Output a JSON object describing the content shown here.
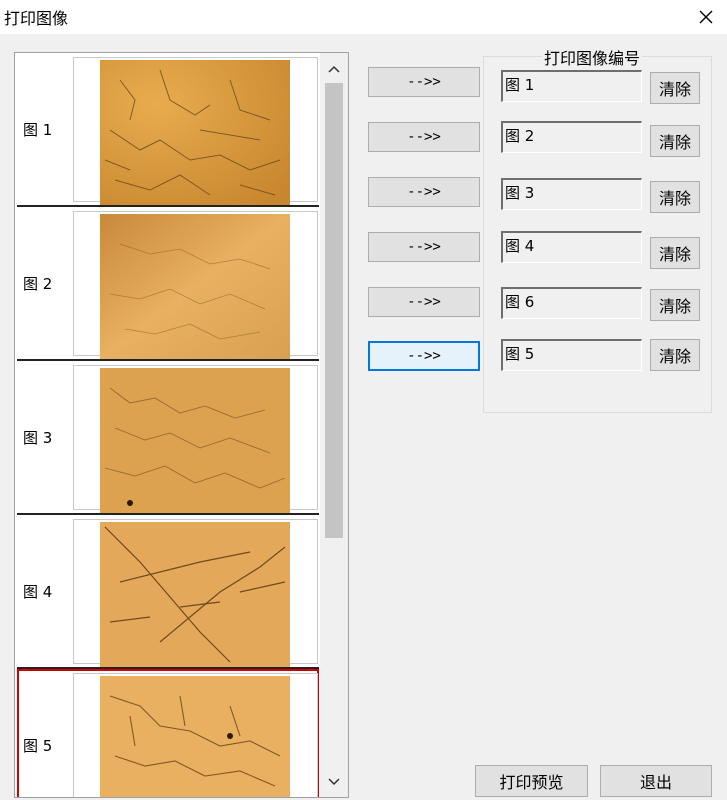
{
  "window": {
    "title": "打印图像",
    "close_icon": "close-icon"
  },
  "image_list": {
    "items": [
      {
        "label": "图 1",
        "selected": false
      },
      {
        "label": "图 2",
        "selected": false
      },
      {
        "label": "图 3",
        "selected": false
      },
      {
        "label": "图 4",
        "selected": false
      },
      {
        "label": "图 5",
        "selected": true
      }
    ]
  },
  "arrow_buttons": [
    "-->>",
    "-->>",
    "-->>",
    "-->>",
    "-->>",
    "-->>"
  ],
  "print_group": {
    "title": "打印图像编号",
    "slots": [
      {
        "value": "图 1",
        "clear_label": "清除"
      },
      {
        "value": "图 2",
        "clear_label": "清除"
      },
      {
        "value": "图 3",
        "clear_label": "清除"
      },
      {
        "value": "图 4",
        "clear_label": "清除"
      },
      {
        "value": "图 6",
        "clear_label": "清除"
      },
      {
        "value": "图 5",
        "clear_label": "清除"
      }
    ]
  },
  "footer": {
    "preview_label": "打印预览",
    "exit_label": "退出"
  },
  "colors": {
    "selection": "#d00000",
    "focus": "#0078d7",
    "micrograph": "#d89a3e"
  }
}
